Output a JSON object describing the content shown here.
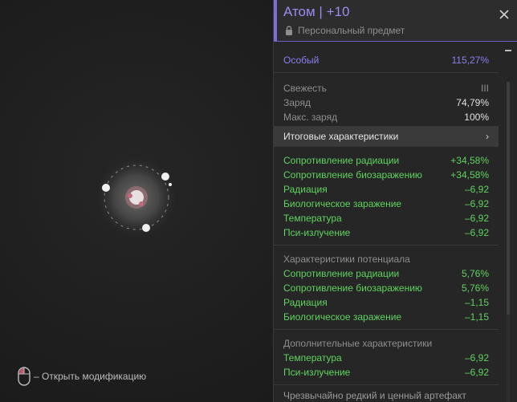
{
  "hint": {
    "text": "– Открыть модификацию",
    "icon": "mouse-icon"
  },
  "item": {
    "title": "Атом | +10",
    "subtitle": "Персональный предмет"
  },
  "stats": {
    "rarity": {
      "label": "Особый",
      "value": "115,27%"
    },
    "basic": [
      {
        "label": "Свежесть",
        "value": "III"
      },
      {
        "label": "Заряд",
        "value": "74,79%"
      },
      {
        "label": "Макс. заряд",
        "value": "100%"
      }
    ]
  },
  "summary_button": {
    "label": "Итоговые характеристики",
    "icon": "chevron-right-icon"
  },
  "summary": [
    {
      "label": "Сопротивление радиации",
      "value": "+34,58%"
    },
    {
      "label": "Сопротивление биозаражению",
      "value": "+34,58%"
    },
    {
      "label": "Радиация",
      "value": "–6,92"
    },
    {
      "label": "Биологическое заражение",
      "value": "–6,92"
    },
    {
      "label": "Температура",
      "value": "–6,92"
    },
    {
      "label": "Пси-излучение",
      "value": "–6,92"
    }
  ],
  "potential": {
    "title": "Характеристики потенциала",
    "rows": [
      {
        "label": "Сопротивление радиации",
        "value": "5,76%"
      },
      {
        "label": "Сопротивление биозаражению",
        "value": "5,76%"
      },
      {
        "label": "Радиация",
        "value": "–1,15"
      },
      {
        "label": "Биологическое заражение",
        "value": "–1,15"
      }
    ]
  },
  "additional": {
    "title": "Дополнительные характеристики",
    "rows": [
      {
        "label": "Температура",
        "value": "–6,92"
      },
      {
        "label": "Пси-излучение",
        "value": "–6,92"
      }
    ]
  },
  "description": "Чрезвычайно редкий и ценный артефакт",
  "colors": {
    "accent": "#8b7ef0",
    "positive": "#5fd35f",
    "panel": "#262626"
  }
}
